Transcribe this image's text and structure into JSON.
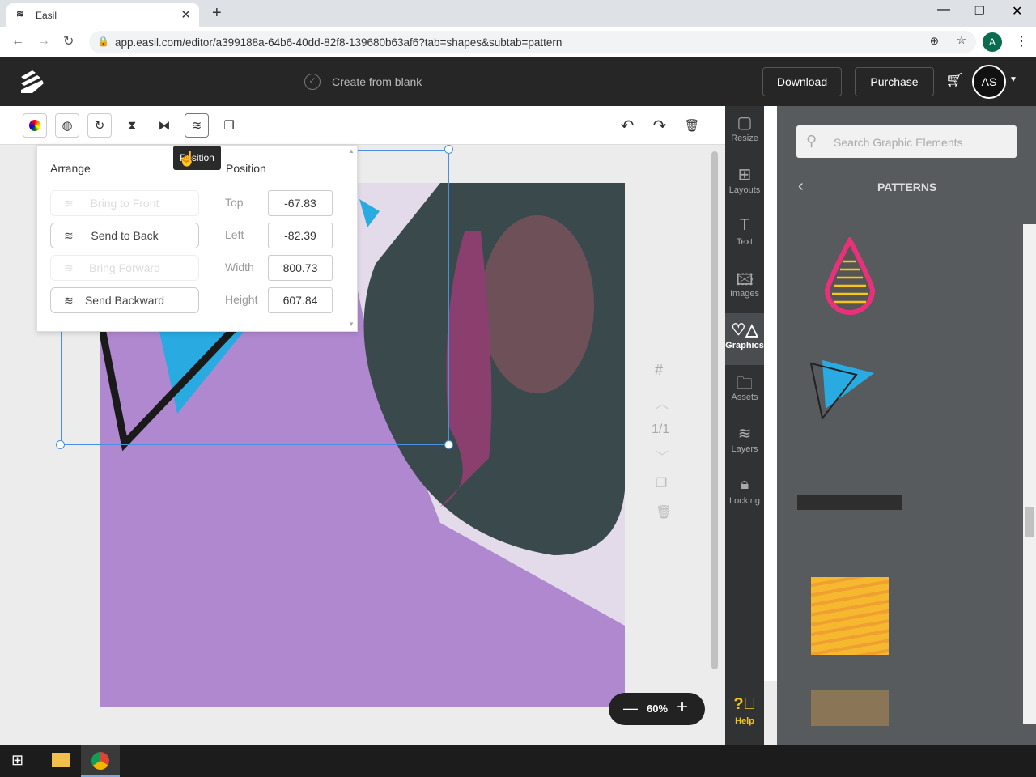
{
  "browser": {
    "tab_title": "Easil",
    "url": "app.easil.com/editor/a399188a-64b6-40dd-82f8-139680b63af6?tab=shapes&subtab=pattern",
    "profile_initial": "A"
  },
  "header": {
    "status": "Create from blank",
    "download": "Download",
    "purchase": "Purchase",
    "avatar": "AS"
  },
  "tooltip": "Position",
  "arrange": {
    "title": "Arrange",
    "buttons": [
      {
        "label": "Bring to Front",
        "disabled": true
      },
      {
        "label": "Send to Back",
        "disabled": false
      },
      {
        "label": "Bring Forward",
        "disabled": true
      },
      {
        "label": "Send Backward",
        "disabled": false
      }
    ]
  },
  "position": {
    "title": "Position",
    "fields": [
      {
        "label": "Top",
        "value": "-67.83"
      },
      {
        "label": "Left",
        "value": "-82.39"
      },
      {
        "label": "Width",
        "value": "800.73"
      },
      {
        "label": "Height",
        "value": "607.84"
      }
    ]
  },
  "page_nav": {
    "page": "1/1"
  },
  "zoom": "60%",
  "rail": [
    {
      "label": "Resize",
      "icon": "resize-icon"
    },
    {
      "label": "Layouts",
      "icon": "layout-icon"
    },
    {
      "label": "Text",
      "icon": "text-icon"
    },
    {
      "label": "Images",
      "icon": "image-icon"
    },
    {
      "label": "Graphics",
      "icon": "shapes-icon",
      "active": true
    },
    {
      "label": "Assets",
      "icon": "folder-icon"
    },
    {
      "label": "Layers",
      "icon": "layers-icon"
    },
    {
      "label": "Locking",
      "icon": "lock-icon"
    }
  ],
  "help": "Help",
  "panel": {
    "search_placeholder": "Search Graphic Elements",
    "title": "PATTERNS"
  },
  "colors": {
    "purple": "#b088d0",
    "accent_blue": "#4a90e2",
    "pink": "#e8317a",
    "yellow": "#f5c518",
    "cyan": "#29abe2"
  }
}
